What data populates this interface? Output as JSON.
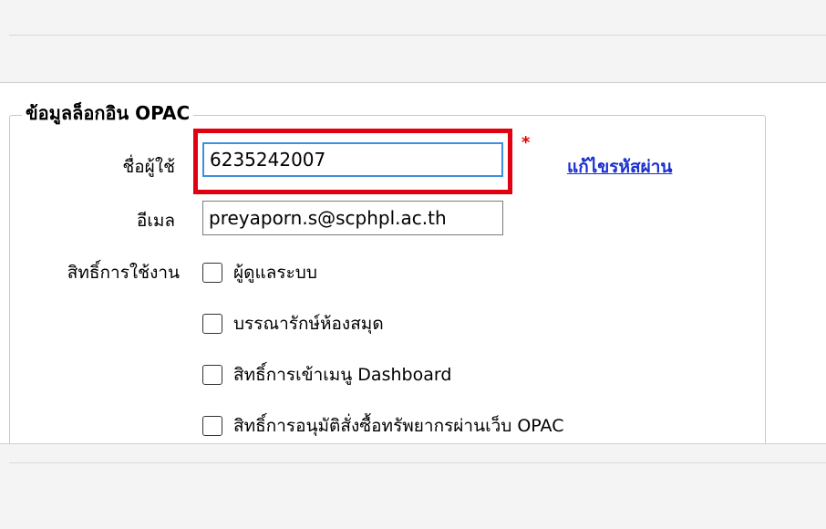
{
  "section": {
    "legend": "ข้อมูลล็อกอิน OPAC"
  },
  "form": {
    "username_label": "ชื่อผู้ใช้",
    "username_value": "6235242007",
    "required_mark": "*",
    "change_password_link": "แก้ไขรหัสผ่าน",
    "email_label": "อีเมล",
    "email_value": "preyaporn.s@scphpl.ac.th",
    "permissions_label": "สิทธิ์การใช้งาน",
    "permissions": [
      {
        "label": "ผู้ดูแลระบบ",
        "checked": false
      },
      {
        "label": "บรรณารักษ์ห้องสมุด",
        "checked": false
      },
      {
        "label": "สิทธิ์การเข้าเมนู Dashboard",
        "checked": false
      },
      {
        "label": "สิทธิ์การอนุมัติสั่งซื้อทรัพยากรผ่านเว็บ OPAC",
        "checked": false
      }
    ]
  },
  "colors": {
    "highlight_border": "#e0000f",
    "link": "#1a2fd0",
    "required": "#e00000",
    "focus_border": "#3d8fe0"
  }
}
